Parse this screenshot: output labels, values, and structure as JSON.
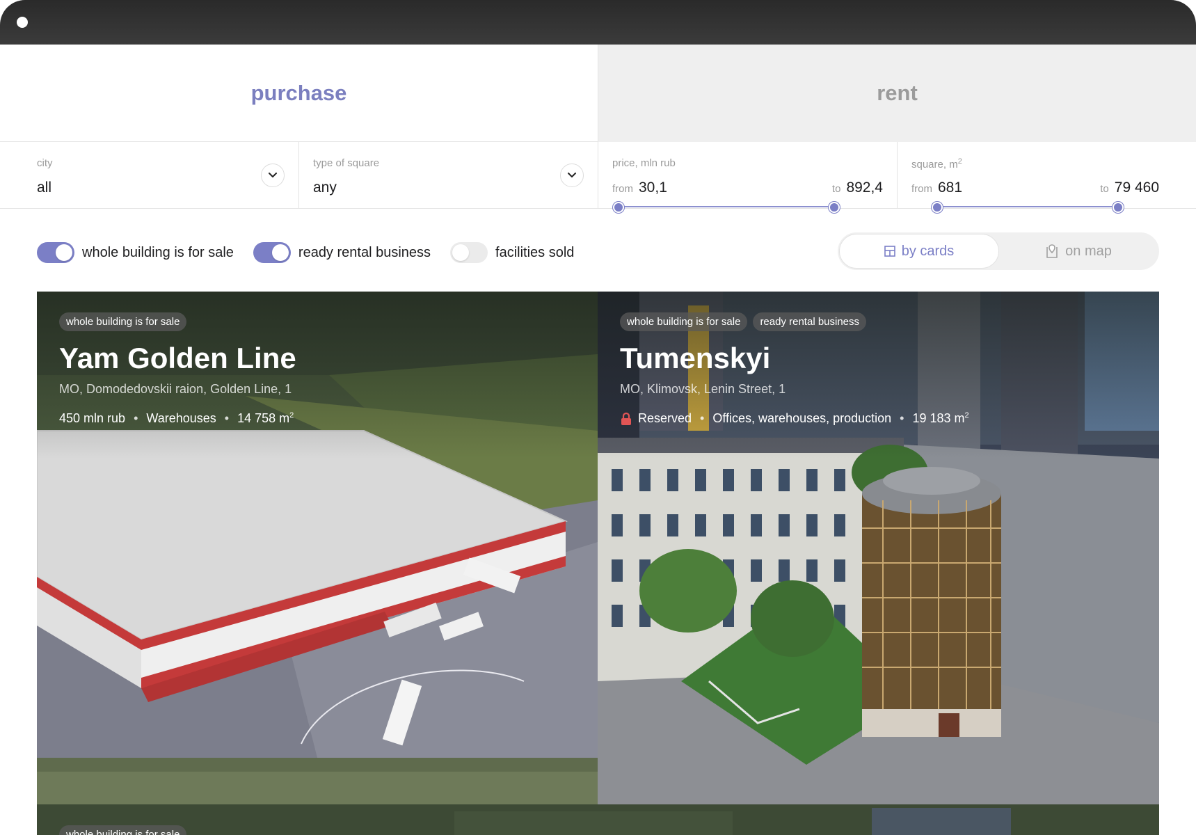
{
  "tabs": {
    "purchase": "purchase",
    "rent": "rent"
  },
  "filters": {
    "city": {
      "label": "city",
      "value": "all"
    },
    "type": {
      "label": "type of square",
      "value": "any"
    },
    "price": {
      "label": "price, mln rub",
      "from_label": "from",
      "from": "30,1",
      "to_label": "to",
      "to": "892,4"
    },
    "square": {
      "label": "square, m",
      "label_sup": "2",
      "from_label": "from",
      "from": "681",
      "to_label": "to",
      "to": "79 460"
    }
  },
  "toggles": [
    {
      "label": "whole building is for sale",
      "on": true
    },
    {
      "label": "ready rental business",
      "on": true
    },
    {
      "label": "facilities sold",
      "on": false
    }
  ],
  "view": {
    "cards": "by cards",
    "map": "on map"
  },
  "cards": [
    {
      "tags": [
        "whole building is for sale"
      ],
      "title": "Yam Golden Line",
      "address": "MO, Domodedovskii raion, Golden Line, 1",
      "price": "450 mln rub",
      "category": "Warehouses",
      "area": "14 758 m",
      "area_sup": "2"
    },
    {
      "tags": [
        "whole building is for sale",
        "ready rental business"
      ],
      "title": "Tumenskyi",
      "address": "MO, Klimovsk, Lenin Street, 1",
      "status": "Reserved",
      "category": "Offices, warehouses, production",
      "area": "19 183 m",
      "area_sup": "2"
    },
    {
      "tags": [
        "whole building is for sale"
      ]
    }
  ],
  "colors": {
    "accent": "#7b7fc6",
    "reserved": "#e25555"
  }
}
